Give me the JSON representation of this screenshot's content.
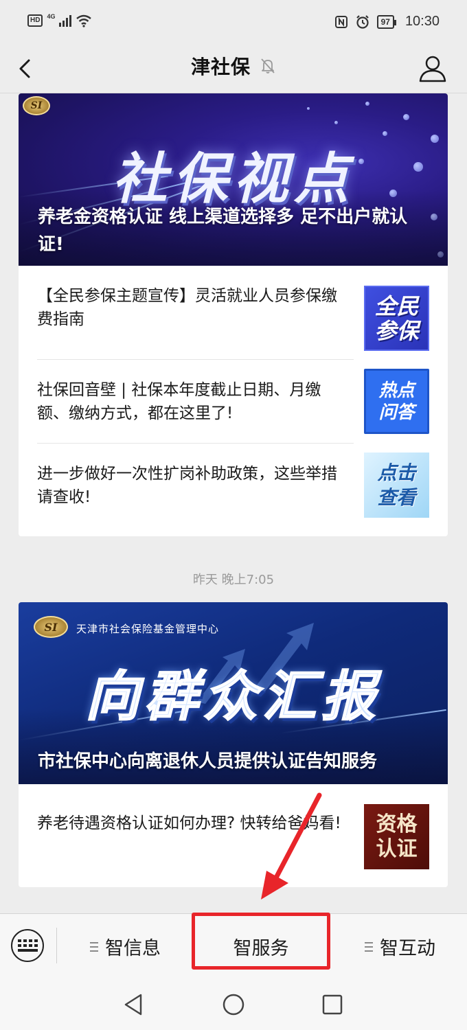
{
  "status_bar": {
    "hd": "HD",
    "network": "4G",
    "battery": "97",
    "time": "10:30"
  },
  "header": {
    "title": "津社保"
  },
  "card1": {
    "banner": {
      "heading": "社保视点",
      "caption": "养老金资格认证 线上渠道选择多 足不出户就认证!",
      "logo": "SI"
    },
    "items": [
      {
        "title": "【全民参保主题宣传】灵活就业人员参保缴费指南",
        "thumb_lines": [
          "全民",
          "参保"
        ]
      },
      {
        "title": "社保回音壁 | 社保本年度截止日期、月缴额、缴纳方式，都在这里了!",
        "thumb_lines": [
          "热点",
          "问答"
        ]
      },
      {
        "title": "进一步做好一次性扩岗补助政策，这些举措请查收!",
        "thumb_lines": [
          "点击",
          "查看"
        ]
      }
    ]
  },
  "timestamp": "昨天 晚上7:05",
  "card2": {
    "banner": {
      "org": "天津市社会保险基金管理中心",
      "heading": "向群众汇报",
      "caption": "市社保中心向离退休人员提供认证告知服务",
      "logo": "SI"
    },
    "items": [
      {
        "title": "养老待遇资格认证如何办理? 快转给爸妈看!",
        "thumb_lines": [
          "资格",
          "认证"
        ]
      }
    ]
  },
  "menu": {
    "items": [
      {
        "label": "智信息"
      },
      {
        "label": "智服务"
      },
      {
        "label": "智互动"
      }
    ]
  },
  "colors": {
    "highlight": "#e8252a",
    "background": "#ededed"
  },
  "icons": [
    "back-arrow-icon",
    "mute-bell-icon",
    "profile-icon",
    "keyboard-icon",
    "menu-lines-icon",
    "nav-back-icon",
    "nav-home-icon",
    "nav-recents-icon"
  ]
}
